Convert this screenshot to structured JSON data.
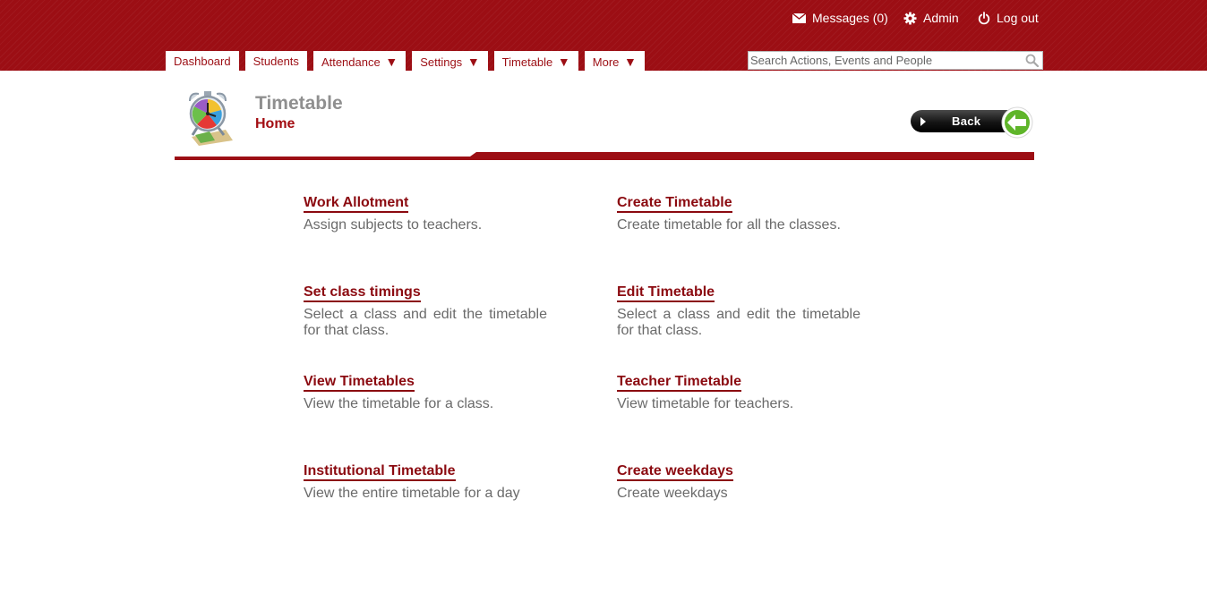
{
  "header": {
    "messages_label": "Messages (0)",
    "admin_label": "Admin",
    "logout_label": "Log out"
  },
  "nav": {
    "tabs": [
      {
        "label": "Dashboard",
        "dropdown": false
      },
      {
        "label": "Students",
        "dropdown": false
      },
      {
        "label": "Attendance",
        "dropdown": true
      },
      {
        "label": "Settings",
        "dropdown": true
      },
      {
        "label": "Timetable",
        "dropdown": true
      },
      {
        "label": "More",
        "dropdown": true
      }
    ],
    "dropdown_glyph": "▼"
  },
  "search": {
    "placeholder": "Search Actions, Events and People"
  },
  "page": {
    "title": "Timetable",
    "subtitle": "Home",
    "icon": "alarm-clock-icon",
    "back_label": "Back"
  },
  "items": [
    {
      "title": "Work Allotment",
      "desc": "Assign subjects to teachers."
    },
    {
      "title": "Create Timetable",
      "desc": "Create timetable for all the classes."
    },
    {
      "title": "Set class timings",
      "desc": "Select a class and edit the timetable for that class."
    },
    {
      "title": "Edit Timetable",
      "desc": "Select a class and edit the timetable for that class."
    },
    {
      "title": "View Timetables",
      "desc": "View the timetable for a class."
    },
    {
      "title": "Teacher Timetable",
      "desc": "View timetable for teachers."
    },
    {
      "title": "Institutional Timetable",
      "desc": "View the entire timetable for a day"
    },
    {
      "title": "Create weekdays",
      "desc": "Create weekdays"
    }
  ],
  "colors": {
    "brand": "#9c0e14",
    "link": "#8b0a10",
    "back_accent": "#5fb52a"
  }
}
